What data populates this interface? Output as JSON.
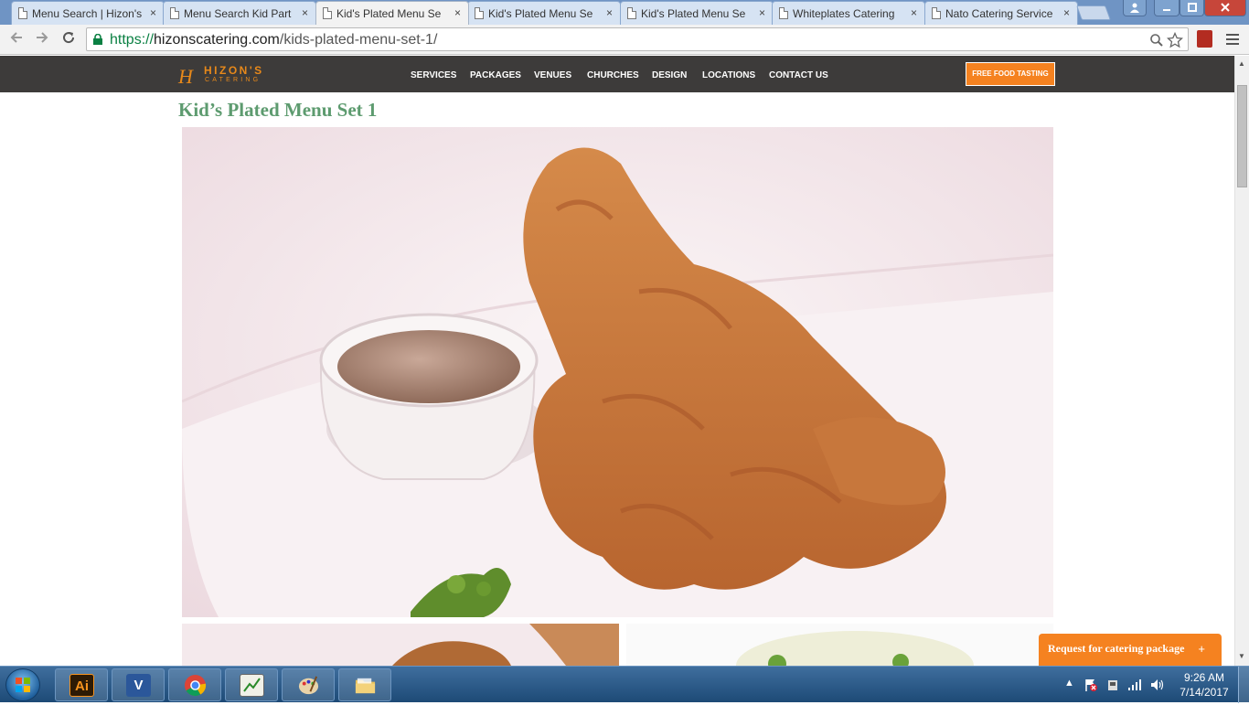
{
  "browser": {
    "tabs": [
      {
        "title": "Menu Search | Hizon's",
        "active": false
      },
      {
        "title": "Menu Search Kid Part",
        "active": false
      },
      {
        "title": "Kid's Plated Menu Se",
        "active": true
      },
      {
        "title": "Kid's Plated Menu Se",
        "active": false
      },
      {
        "title": "Kid's Plated Menu Se",
        "active": false
      },
      {
        "title": "Whiteplates Catering",
        "active": false
      },
      {
        "title": "Nato Catering Service",
        "active": false
      }
    ],
    "close_glyph": "×",
    "url": {
      "scheme": "https://",
      "host": "hizonscatering.com",
      "path": "/kids-plated-menu-set-1/"
    }
  },
  "site": {
    "logo": {
      "mark": "H",
      "name": "HIZON'S",
      "sub": "CATERING"
    },
    "nav": [
      "SERVICES",
      "PACKAGES",
      "VENUES",
      "CHURCHES",
      "DESIGN",
      "LOCATIONS",
      "CONTACT US"
    ],
    "cta": "FREE FOOD TASTING",
    "page_title": "Kid’s Plated Menu Set 1",
    "request_bar": {
      "label": "Request for catering package",
      "plus": "+"
    }
  },
  "taskbar": {
    "apps": [
      {
        "name": "illustrator",
        "label": "Ai"
      },
      {
        "name": "visio",
        "label": "V"
      },
      {
        "name": "chrome",
        "label": ""
      },
      {
        "name": "sheets",
        "label": ""
      },
      {
        "name": "paint",
        "label": ""
      },
      {
        "name": "explorer",
        "label": ""
      }
    ],
    "time": "9:26 AM",
    "date": "7/14/2017"
  },
  "colors": {
    "accent": "#f58220",
    "title_green": "#5d9b6f",
    "header_bg": "#3d3b3a"
  }
}
